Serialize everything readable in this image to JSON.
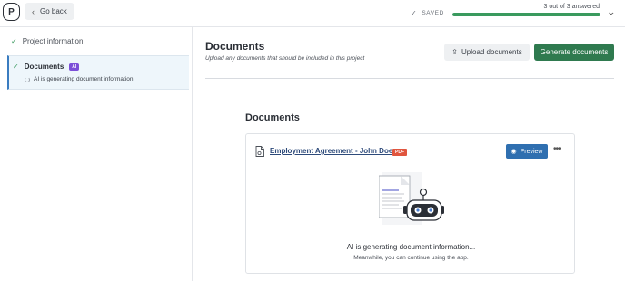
{
  "header": {
    "logo_letter": "P",
    "back_label": "Go back",
    "saved_label": "SAVED",
    "progress_label": "3 out of 3 answered",
    "progress_fraction": 1.0
  },
  "sidebar": {
    "items": [
      {
        "label": "Project information",
        "completed": true
      },
      {
        "label": "Documents",
        "badge": "AI",
        "status": "AI is generating document information",
        "completed": true,
        "active": true
      }
    ]
  },
  "main": {
    "title": "Documents",
    "subtitle": "Upload any documents that should be included in this project",
    "upload_label": "Upload documents",
    "generate_label": "Generate documents",
    "section_title": "Documents",
    "document": {
      "name": "Employment Agreement - John Doe",
      "type_badge": "PDF",
      "preview_label": "Preview",
      "more_label": "•••",
      "generating_title": "AI is generating document information...",
      "generating_sub": "Meanwhile, you can continue using the app."
    }
  },
  "colors": {
    "primary_green": "#2f7a4f",
    "progress_green": "#3a9a5e",
    "preview_blue": "#2f6fb0",
    "ai_badge": "#7b4fd8",
    "pdf_badge": "#e0553e"
  }
}
